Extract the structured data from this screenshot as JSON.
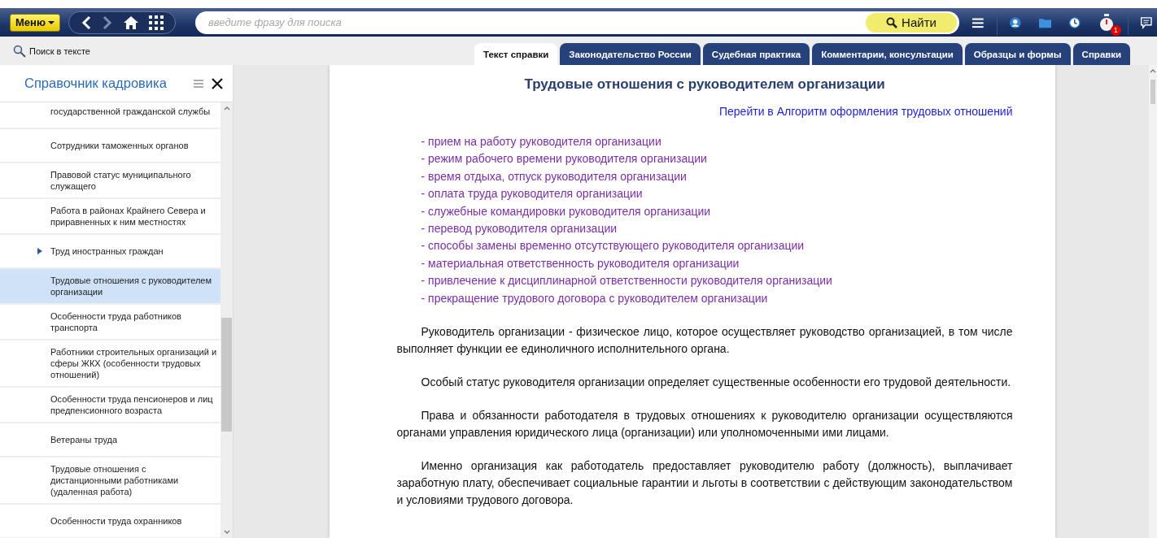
{
  "toolbar": {
    "menu_button": "Меню",
    "search": {
      "placeholder": "введите фразу для поиска"
    },
    "find_button": "Найти",
    "notification_count": "1"
  },
  "text_search": "Поиск в тексте",
  "tabs": [
    {
      "label": "Текст справки",
      "selected": true
    },
    {
      "label": "Законодательство России",
      "selected": false
    },
    {
      "label": "Судебная практика",
      "selected": false
    },
    {
      "label": "Комментарии, консультации",
      "selected": false
    },
    {
      "label": "Образцы и формы",
      "selected": false
    },
    {
      "label": "Справки",
      "selected": false
    }
  ],
  "sidebar": {
    "title": "Справочник кадровика",
    "items": [
      {
        "label": "государственной гражданской службы",
        "expandable": false,
        "selected": false
      },
      {
        "label": "Сотрудники таможенных органов",
        "expandable": false,
        "selected": false
      },
      {
        "label": "Правовой статус муниципального служащего",
        "expandable": false,
        "selected": false
      },
      {
        "label": "Работа в районах Крайнего Севера и приравненных к ним местностях",
        "expandable": false,
        "selected": false
      },
      {
        "label": "Труд иностранных граждан",
        "expandable": true,
        "selected": false
      },
      {
        "label": "Трудовые отношения с руководителем организации",
        "expandable": false,
        "selected": true
      },
      {
        "label": "Особенности труда работников транспорта",
        "expandable": false,
        "selected": false
      },
      {
        "label": "Работники строительных организаций и сферы ЖКХ (особенности трудовых отношений)",
        "expandable": false,
        "selected": false
      },
      {
        "label": "Особенности труда пенсионеров и лиц предпенсионного возраста",
        "expandable": false,
        "selected": false
      },
      {
        "label": "Ветераны труда",
        "expandable": false,
        "selected": false
      },
      {
        "label": "Трудовые отношения с дистанционными работниками (удаленная работа)",
        "expandable": false,
        "selected": false
      },
      {
        "label": "Особенности труда охранников",
        "expandable": false,
        "selected": false
      }
    ]
  },
  "document": {
    "title": "Трудовые отношения с руководителем организации",
    "algorithm_link": "Перейти в Алгоритм оформления трудовых отношений",
    "links": [
      "- прием на работу руководителя организации",
      "- режим рабочего времени руководителя организации",
      "- время отдыха, отпуск руководителя организации",
      "- оплата труда руководителя организации",
      "- служебные командировки руководителя организации",
      "- перевод руководителя организации",
      "- способы замены временно отсутствующего руководителя организации",
      "- материальная ответственность руководителя организации",
      "- привлечение к дисциплинарной ответственности руководителя организации",
      "- прекращение трудового договора с руководителем организации"
    ],
    "paragraphs": [
      "Руководитель организации - физическое лицо, которое осуществляет руководство организацией, в том числе выполняет функции ее единоличного исполнительного органа.",
      "Особый статус руководителя организации определяет существенные особенности его трудовой деятельности.",
      "Права и обязанности работодателя в трудовых отношениях к руководителю организации осуществляются органами управления юридического лица (организации) или уполномоченными ими лицами.",
      "Именно организация как работодатель предоставляет руководителю работу (должность), выплачивает заработную плату, обеспечивает социальные гарантии и льготы в соответствии с действующим законодательством и условиями трудового договора."
    ]
  }
}
